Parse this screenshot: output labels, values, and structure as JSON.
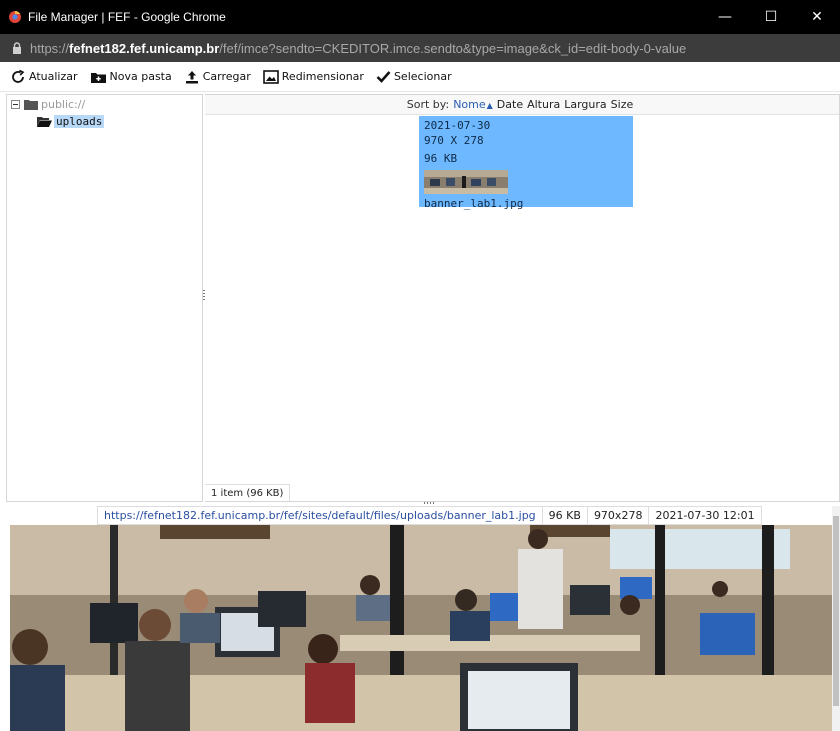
{
  "window": {
    "title": "File Manager | FEF - Google Chrome",
    "controls": {
      "minimize": "—",
      "maximize": "☐",
      "close": "✕"
    }
  },
  "address": {
    "scheme": "https://",
    "host": "fefnet182.fef.unicamp.br",
    "rest": "/fef/imce?sendto=CKEDITOR.imce.sendto&type=image&ck_id=edit-body-0-value"
  },
  "toolbar": {
    "refresh": "Atualizar",
    "new_folder": "Nova pasta",
    "upload": "Carregar",
    "resize": "Redimensionar",
    "select": "Selecionar"
  },
  "tree": {
    "root": "public://",
    "child": "uploads"
  },
  "sort": {
    "label": "Sort by:",
    "options": [
      "Nome",
      "Date",
      "Altura",
      "Largura",
      "Size"
    ],
    "active_arrow": "▲"
  },
  "file": {
    "date": "2021-07-30",
    "dimensions": "970 X 278",
    "size": "96 KB",
    "name": "banner_lab1.jpg"
  },
  "status": {
    "items": "1 item (96 KB)"
  },
  "preview": {
    "url": "https://fefnet182.fef.unicamp.br/fef/sites/default/files/uploads/banner_lab1.jpg",
    "size": "96 KB",
    "dims": "970x278",
    "datetime": "2021-07-30 12:01"
  },
  "colors": {
    "selection": "#6db8ff",
    "tree_selection": "#b8d8f8",
    "link": "#2a5db0"
  }
}
